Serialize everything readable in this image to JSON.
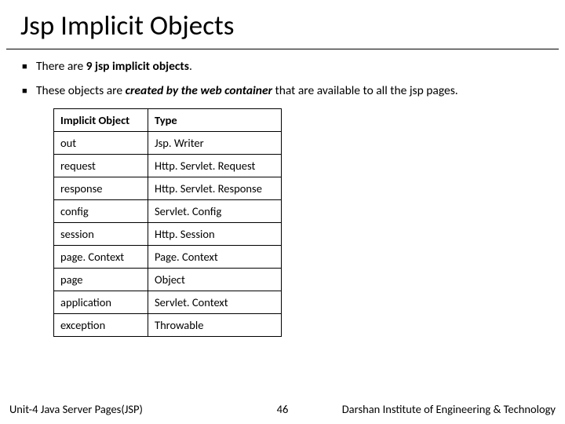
{
  "title": "Jsp Implicit Objects",
  "bullets": {
    "b1_pre": "There are ",
    "b1_bold": "9 jsp implicit objects",
    "b1_post": ".",
    "b2_pre": "These objects are ",
    "b2_em": "created by the web container",
    "b2_post": " that are available to all the jsp pages."
  },
  "table": {
    "h1": "Implicit Object",
    "h2": "Type",
    "rows": [
      {
        "c1": " out",
        "c2": " Jsp. Writer"
      },
      {
        "c1": "request",
        "c2": "Http. Servlet. Request"
      },
      {
        "c1": "response",
        "c2": "Http. Servlet. Response"
      },
      {
        "c1": "config",
        "c2": "Servlet. Config"
      },
      {
        "c1": "session",
        "c2": "Http. Session"
      },
      {
        "c1": "page. Context",
        "c2": "Page. Context"
      },
      {
        "c1": "page",
        "c2": "Object"
      },
      {
        "c1": "application",
        "c2": "Servlet. Context"
      },
      {
        "c1": "exception",
        "c2": "Throwable"
      }
    ]
  },
  "footer": {
    "left": "Unit-4 Java Server Pages(JSP)",
    "page": "46",
    "right": "Darshan Institute of Engineering & Technology"
  }
}
